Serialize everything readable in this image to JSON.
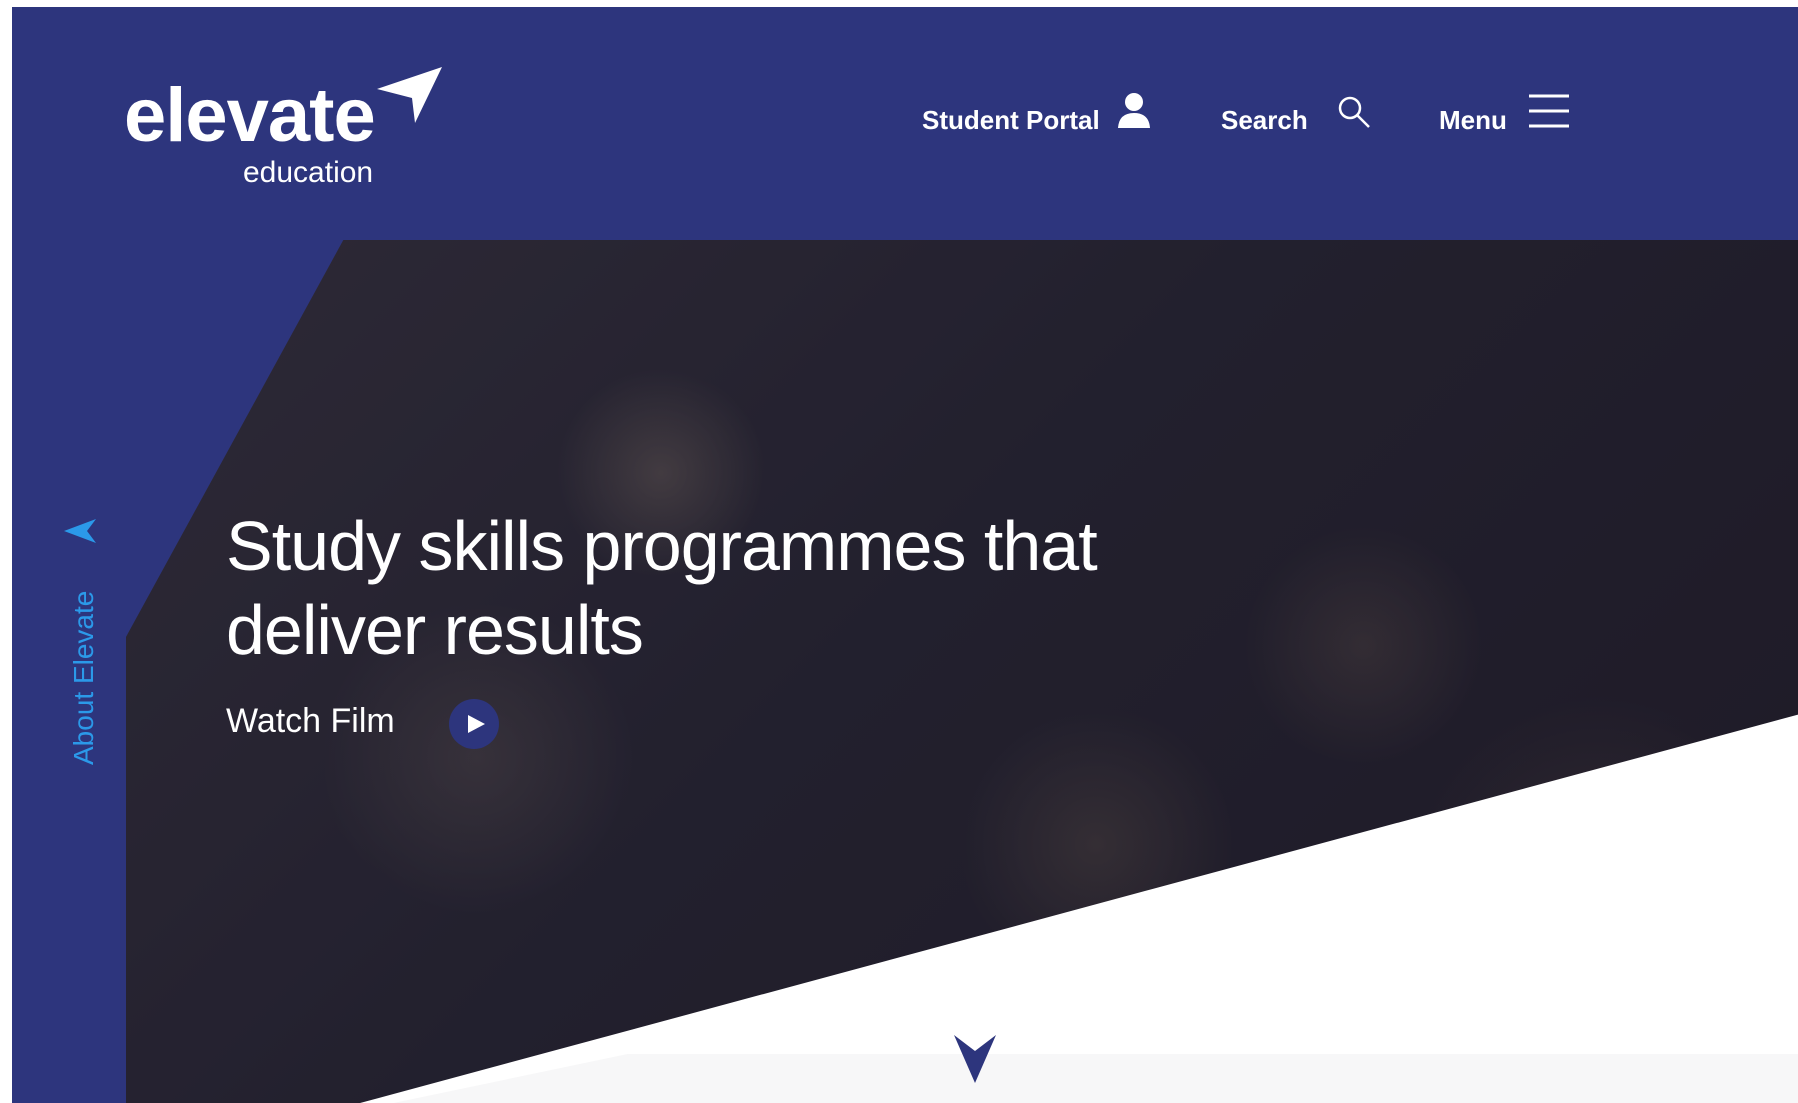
{
  "logo": {
    "word": "elevate",
    "sub": "education"
  },
  "nav": {
    "student_portal": "Student Portal",
    "search": "Search",
    "menu": "Menu"
  },
  "side_tab": {
    "label": "About Elevate"
  },
  "hero": {
    "headline_line1": "Study skills programmes that",
    "headline_line2": "deliver results",
    "watch_label": "Watch Film"
  },
  "icons": {
    "user": "user-icon",
    "search": "search-icon",
    "menu": "hamburger-icon",
    "play": "play-icon",
    "down": "chevron-down-icon",
    "side_arrow": "arrow-left-icon"
  },
  "colors": {
    "brand_navy": "#2d357d",
    "accent_blue": "#2b99e9"
  }
}
